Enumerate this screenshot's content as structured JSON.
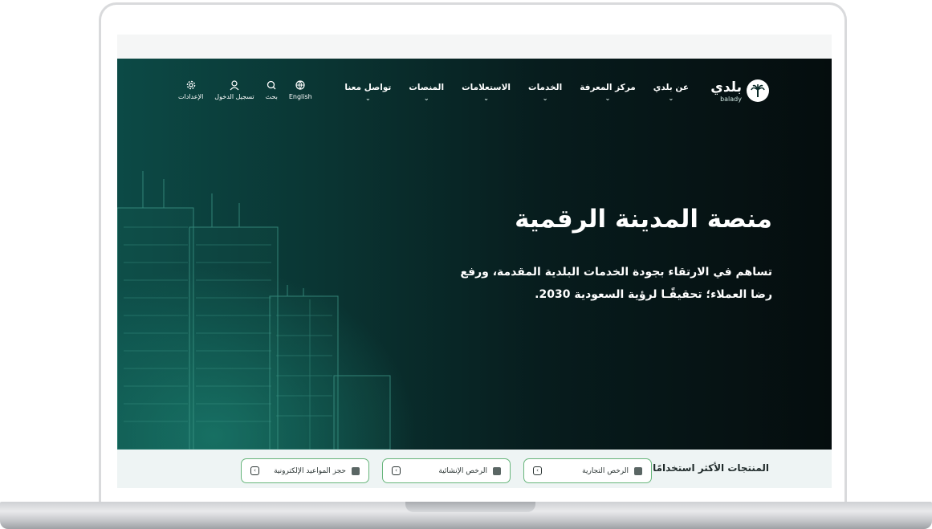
{
  "nav": {
    "logo": {
      "arabic": "بلدي",
      "english": "balady"
    },
    "menu": [
      {
        "label": "عن بلدي"
      },
      {
        "label": "مركز المعرفة"
      },
      {
        "label": "الخدمات"
      },
      {
        "label": "الاستعلامات"
      },
      {
        "label": "المنصات"
      },
      {
        "label": "تواصل معنا"
      }
    ],
    "utilities": [
      {
        "label": "English",
        "icon": "globe-icon"
      },
      {
        "label": "بحث",
        "icon": "search-icon"
      },
      {
        "label": "تسجيل الدخول",
        "icon": "user-icon"
      },
      {
        "label": "الإعدادات",
        "icon": "gear-icon"
      }
    ]
  },
  "hero": {
    "title": "منصة المدينة الرقمية",
    "subtitle": "تساهم في الارتقاء بجودة الخدمات البلدية المقدمة، ورفع رضا العملاء؛ تحقيقًـا لرؤية السعودية 2030."
  },
  "most_used": {
    "label": "المنتجات الأكثر استخدامًا",
    "items": [
      {
        "label": "الرخص التجارية"
      },
      {
        "label": "الرخص الإنشائية"
      },
      {
        "label": "حجز المواعيد الإلكترونية"
      }
    ]
  },
  "colors": {
    "hero_dark": "#050d0e",
    "hero_teal": "#0c4a46",
    "accent_green": "#67b57b",
    "bar_bg": "#eef4f4"
  }
}
